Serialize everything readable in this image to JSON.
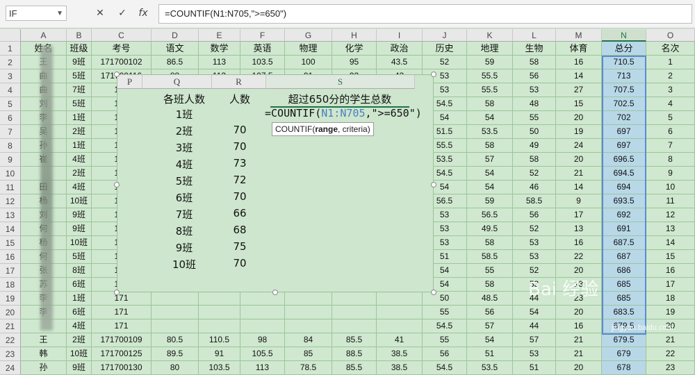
{
  "formula_bar": {
    "name_box": "IF",
    "cancel_icon": "✕",
    "enter_icon": "✓",
    "fx_icon": "fx",
    "formula": "=COUNTIF(N1:N705,\">=650\")"
  },
  "columns": [
    "A",
    "B",
    "C",
    "D",
    "E",
    "F",
    "G",
    "H",
    "I",
    "J",
    "K",
    "L",
    "M",
    "N",
    "O"
  ],
  "rows": [
    {
      "n": "1",
      "c": [
        "姓名",
        "班级",
        "考号",
        "语文",
        "数学",
        "英语",
        "物理",
        "化学",
        "政治",
        "历史",
        "地理",
        "生物",
        "体育",
        "总分",
        "名次"
      ]
    },
    {
      "n": "2",
      "c": [
        "王",
        "9班",
        "171700102",
        "86.5",
        "113",
        "103.5",
        "100",
        "95",
        "43.5",
        "52",
        "59",
        "58",
        "16",
        "710.5",
        "1"
      ]
    },
    {
      "n": "3",
      "c": [
        "曲",
        "5班",
        "171700116",
        "88",
        "113",
        "107.5",
        "91",
        "92",
        "43",
        "53",
        "55.5",
        "56",
        "14",
        "713",
        "2"
      ]
    },
    {
      "n": "4",
      "c": [
        "曲",
        "7班",
        "171",
        "",
        "",
        "",
        "",
        "",
        "",
        "53",
        "55.5",
        "53",
        "27",
        "707.5",
        "3"
      ]
    },
    {
      "n": "5",
      "c": [
        "刘",
        "5班",
        "171",
        "",
        "",
        "",
        "",
        "",
        "",
        "54.5",
        "58",
        "48",
        "15",
        "702.5",
        "4"
      ]
    },
    {
      "n": "6",
      "c": [
        "李",
        "1班",
        "171",
        "",
        "",
        "",
        "",
        "",
        "",
        "54",
        "54",
        "55",
        "20",
        "702",
        "5"
      ]
    },
    {
      "n": "7",
      "c": [
        "吴",
        "2班",
        "171",
        "",
        "",
        "",
        "",
        "",
        "",
        "51.5",
        "53.5",
        "50",
        "19",
        "697",
        "6"
      ]
    },
    {
      "n": "8",
      "c": [
        "孙",
        "1班",
        "171",
        "",
        "",
        "",
        "",
        "",
        "",
        "55.5",
        "58",
        "49",
        "24",
        "697",
        "7"
      ]
    },
    {
      "n": "9",
      "c": [
        "崔",
        "4班",
        "171",
        "",
        "",
        "",
        "",
        "",
        "",
        "53.5",
        "57",
        "58",
        "20",
        "696.5",
        "8"
      ]
    },
    {
      "n": "10",
      "c": [
        "",
        "2班",
        "171",
        "",
        "",
        "",
        "",
        "",
        "",
        "54.5",
        "54",
        "52",
        "21",
        "694.5",
        "9"
      ]
    },
    {
      "n": "11",
      "c": [
        "田",
        "4班",
        "171",
        "",
        "",
        "",
        "",
        "",
        "",
        "54",
        "54",
        "46",
        "14",
        "694",
        "10"
      ]
    },
    {
      "n": "12",
      "c": [
        "杨",
        "10班",
        "171",
        "",
        "",
        "",
        "",
        "",
        "",
        "56.5",
        "59",
        "58.5",
        "9",
        "693.5",
        "11"
      ]
    },
    {
      "n": "13",
      "c": [
        "刘",
        "9班",
        "171",
        "",
        "",
        "",
        "",
        "",
        "",
        "53",
        "56.5",
        "56",
        "17",
        "692",
        "12"
      ]
    },
    {
      "n": "14",
      "c": [
        "何",
        "9班",
        "171",
        "",
        "",
        "",
        "",
        "",
        "",
        "53",
        "49.5",
        "52",
        "13",
        "691",
        "13"
      ]
    },
    {
      "n": "15",
      "c": [
        "杨",
        "10班",
        "171",
        "",
        "",
        "",
        "",
        "",
        "",
        "53",
        "58",
        "53",
        "16",
        "687.5",
        "14"
      ]
    },
    {
      "n": "16",
      "c": [
        "何",
        "5班",
        "171",
        "",
        "",
        "",
        "",
        "",
        "",
        "51",
        "58.5",
        "53",
        "22",
        "687",
        "15"
      ]
    },
    {
      "n": "17",
      "c": [
        "张",
        "8班",
        "171",
        "",
        "",
        "",
        "",
        "",
        "",
        "54",
        "55",
        "52",
        "20",
        "686",
        "16"
      ]
    },
    {
      "n": "18",
      "c": [
        "苏",
        "6班",
        "171",
        "",
        "",
        "",
        "",
        "",
        "",
        "54",
        "58",
        "53",
        "13",
        "685",
        "17"
      ]
    },
    {
      "n": "19",
      "c": [
        "李",
        "1班",
        "171",
        "",
        "",
        "",
        "",
        "",
        "",
        "50",
        "48.5",
        "44",
        "23",
        "685",
        "18"
      ]
    },
    {
      "n": "20",
      "c": [
        "李",
        "6班",
        "171",
        "",
        "",
        "",
        "",
        "",
        "",
        "55",
        "56",
        "54",
        "20",
        "683.5",
        "19"
      ]
    },
    {
      "n": "21",
      "c": [
        "",
        "4班",
        "171",
        "",
        "",
        "",
        "",
        "",
        "",
        "54.5",
        "57",
        "44",
        "16",
        "679.5",
        "20"
      ]
    },
    {
      "n": "22",
      "c": [
        "王",
        "2班",
        "171700109",
        "80.5",
        "110.5",
        "98",
        "84",
        "85.5",
        "41",
        "55",
        "54",
        "57",
        "21",
        "679.5",
        "21"
      ]
    },
    {
      "n": "23",
      "c": [
        "韩",
        "10班",
        "171700125",
        "89.5",
        "91",
        "105.5",
        "85",
        "88.5",
        "38.5",
        "56",
        "51",
        "53",
        "21",
        "679",
        "22"
      ]
    },
    {
      "n": "24",
      "c": [
        "孙",
        "9班",
        "171700130",
        "80",
        "103.5",
        "113",
        "78.5",
        "85.5",
        "38.5",
        "54.5",
        "53.5",
        "51",
        "20",
        "678",
        "23"
      ]
    }
  ],
  "panel": {
    "columns": [
      "P",
      "Q",
      "R",
      "S"
    ],
    "title_q": "各班人数",
    "title_r": "人数",
    "title_s": "超过650分的学生总数",
    "classes": [
      "1班",
      "2班",
      "3班",
      "4班",
      "5班",
      "6班",
      "7班",
      "8班",
      "9班",
      "10班"
    ],
    "counts": [
      "",
      "70",
      "70",
      "73",
      "72",
      "70",
      "66",
      "68",
      "75",
      "70"
    ],
    "formula_prefix": "=COUNTIF(",
    "formula_ref": "N1:N705",
    "formula_suffix": ",\">=650\")",
    "tooltip_fn": "COUNTIF(",
    "tooltip_arg1": "range",
    "tooltip_rest": ", criteria)"
  },
  "watermark": {
    "brand": "Bai 经验",
    "url": "jingyan.baidu.com"
  }
}
